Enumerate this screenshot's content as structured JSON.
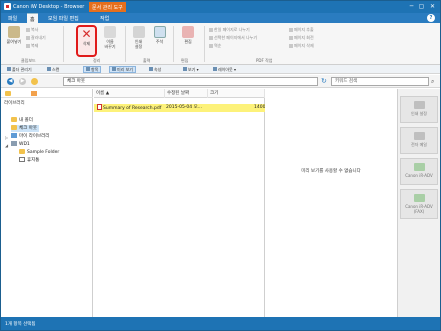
{
  "window": {
    "title": "Canon iW Desktop - Browser",
    "context_tab": "문서 관리 도구",
    "controls": [
      "─",
      "▢",
      "✕"
    ]
  },
  "ribbon_tabs": [
    "파일",
    "홈",
    "모임 파일 편집",
    "작업"
  ],
  "ribbon": {
    "clipboard": {
      "paste": "붙여넣기",
      "copy": "복사",
      "cut": "잘라내기",
      "duplicate": "복제",
      "group": "클립보드"
    },
    "organize": {
      "delete": "삭제",
      "rename": "이름\n바꾸기",
      "group": "정리"
    },
    "output": {
      "print": "인쇄\n설정",
      "annotate": "주석",
      "group": "출력"
    },
    "edit": {
      "edit": "편집",
      "group": "편집"
    },
    "pdf": {
      "items": [
        "한일 페이지로 나누기",
        "선택한 페이지에서 나누기",
        "역순",
        "페이지 추출",
        "페이지 회전",
        "페이지 삭제"
      ],
      "group": "PDF 작업"
    }
  },
  "view_toolbar": {
    "items": [
      "폴더 관리기",
      "스캔",
      "항목",
      "미리 보기",
      "속성",
      "보기 ▾",
      "레이아웃 ▾"
    ],
    "active": [
      "항목",
      "미리 보기"
    ]
  },
  "address": {
    "path": "체크 아웃",
    "search_placeholder": "키워드 검색"
  },
  "tree": {
    "heading": "라이브러리",
    "items": [
      {
        "label": "내 폴더"
      },
      {
        "label": "체크 아웃",
        "selected": true
      },
      {
        "label": "마이 라이브러리"
      },
      {
        "label": "WD1"
      },
      {
        "label": "Sample Folder"
      },
      {
        "label": "휴지통"
      }
    ]
  },
  "file_list": {
    "columns": [
      "이름 ▲",
      "수정된 날짜",
      "크기"
    ],
    "rows": [
      {
        "name": "Summary of Research.pdf",
        "modified": "2015-05-04 오...",
        "size": "1400"
      }
    ]
  },
  "preview": {
    "message": "미리 보기를 사용할 수 없습니다"
  },
  "dock": {
    "buttons": [
      "인쇄 설정",
      "전자 메일",
      "Canon iR-ADV",
      "Canon iR-ADV\n(FAX)"
    ]
  },
  "status": {
    "text": "1개 항목 선택됨"
  },
  "colors": {
    "titlebar": "#1e73b4",
    "context_tab": "#e56f1d",
    "selected_row": "#fdf27a",
    "delete_highlight": "#e01a1a"
  }
}
